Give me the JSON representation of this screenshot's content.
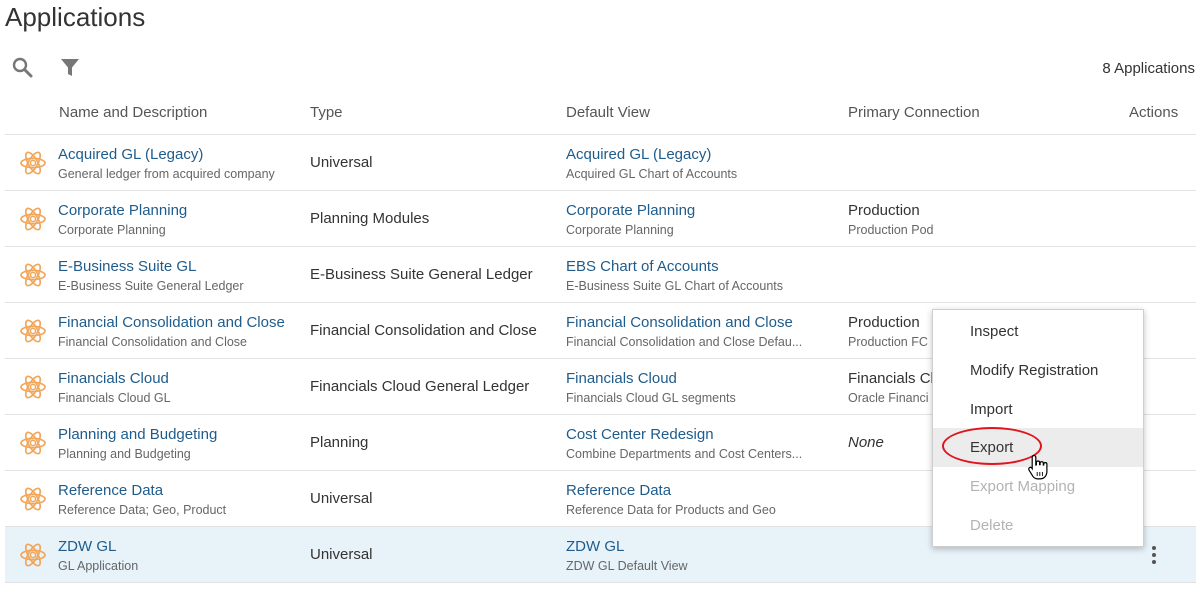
{
  "page": {
    "title": "Applications"
  },
  "toolbar": {
    "search_icon": "search-icon",
    "filter_icon": "filter-icon",
    "count_label": "8 Applications"
  },
  "table": {
    "headers": {
      "name": "Name and Description",
      "type": "Type",
      "default_view": "Default View",
      "primary_connection": "Primary Connection",
      "actions": "Actions"
    },
    "rows": [
      {
        "name": "Acquired GL (Legacy)",
        "description": "General ledger from acquired company",
        "type": "Universal",
        "view_name": "Acquired GL (Legacy)",
        "view_description": "Acquired GL Chart of Accounts",
        "conn_name": "",
        "conn_description": ""
      },
      {
        "name": "Corporate Planning",
        "description": "Corporate Planning",
        "type": "Planning Modules",
        "view_name": "Corporate Planning",
        "view_description": "Corporate Planning",
        "conn_name": "Production",
        "conn_description": "Production Pod"
      },
      {
        "name": "E-Business Suite GL",
        "description": "E-Business Suite General Ledger",
        "type": "E-Business Suite General Ledger",
        "view_name": "EBS Chart of Accounts",
        "view_description": "E-Business Suite GL Chart of Accounts",
        "conn_name": "",
        "conn_description": ""
      },
      {
        "name": "Financial Consolidation and Close",
        "description": "Financial Consolidation and Close",
        "type": "Financial Consolidation and Close",
        "view_name": "Financial Consolidation and Close",
        "view_description": "Financial Consolidation and Close Defau...",
        "conn_name": "Production",
        "conn_description": "Production FC"
      },
      {
        "name": "Financials Cloud",
        "description": "Financials Cloud GL",
        "type": "Financials Cloud General Ledger",
        "view_name": "Financials Cloud",
        "view_description": "Financials Cloud GL segments",
        "conn_name": "Financials Cl",
        "conn_description": "Oracle Financi"
      },
      {
        "name": "Planning and Budgeting",
        "description": "Planning and Budgeting",
        "type": "Planning",
        "view_name": "Cost Center Redesign",
        "view_description": "Combine Departments and Cost Centers...",
        "conn_name": "None",
        "conn_description": ""
      },
      {
        "name": "Reference Data",
        "description": "Reference Data; Geo, Product",
        "type": "Universal",
        "view_name": "Reference Data",
        "view_description": "Reference Data for Products and Geo",
        "conn_name": "",
        "conn_description": ""
      },
      {
        "name": "ZDW GL",
        "description": "GL Application",
        "type": "Universal",
        "view_name": "ZDW GL",
        "view_description": "ZDW GL Default View",
        "conn_name": "",
        "conn_description": ""
      }
    ]
  },
  "actions_menu": {
    "items": [
      {
        "label": "Inspect",
        "state": "enabled"
      },
      {
        "label": "Modify Registration",
        "state": "enabled"
      },
      {
        "label": "Import",
        "state": "enabled"
      },
      {
        "label": "Export",
        "state": "hover"
      },
      {
        "label": "Export Mapping",
        "state": "disabled"
      },
      {
        "label": "Delete",
        "state": "disabled"
      }
    ]
  },
  "colors": {
    "link": "#1f5c8b",
    "app_icon": "#f2a65a",
    "selected_row": "#e8f2f9",
    "highlight_ring": "#e0141e"
  }
}
